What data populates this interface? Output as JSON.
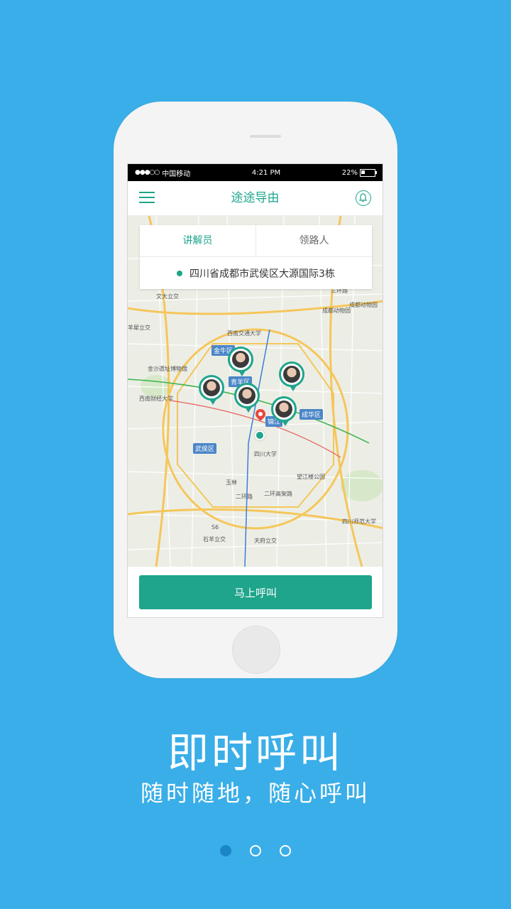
{
  "status_bar": {
    "signal": "●●●○○",
    "carrier": "中国移动",
    "time": "4:21 PM",
    "battery": "22%"
  },
  "navbar": {
    "title": "途途导由",
    "menu_icon": "hamburger-menu-icon",
    "bell_icon": "bell-icon"
  },
  "tabs": [
    {
      "label": "讲解员",
      "active": true
    },
    {
      "label": "领路人",
      "active": false
    }
  ],
  "address": "四川省成都市武侯区大源国际3栋",
  "map": {
    "labels": {
      "xidajiao": "文大立交",
      "chengdu_zoo": "成都动物园",
      "chengdu_zoo_2": "成都动物园",
      "xinan_jiaotong": "西南交通大学",
      "jinsha": "金沙遗址博物馆",
      "xinan_caijing": "西南财经大学",
      "sichuan_daxue": "四川大学",
      "wangjiang": "望江楼公园",
      "sichuan_shifan": "四川师范大学",
      "yulin": "玉林",
      "yangshi_lijiao": "羊犀立交",
      "ershi_gaojia": "二环高架路",
      "erhuan_road": "二环路",
      "sanhuan_road": "三环路",
      "shiyang": "石羊立交",
      "tianfu": "天府立交",
      "s6": "S6"
    },
    "districts": {
      "jinniu": "金牛区",
      "qingyang": "青羊区",
      "chenghua": "成华区",
      "wuhou": "武侯区",
      "jinjiang": "锦江"
    }
  },
  "call_button": "马上呼叫",
  "headline": "即时呼叫",
  "subline": "随时随地，随心呼叫",
  "pagination": {
    "total": 3,
    "active": 1
  },
  "colors": {
    "background": "#3aaee8",
    "accent": "#1ea58c",
    "pin_red": "#e8473c"
  }
}
